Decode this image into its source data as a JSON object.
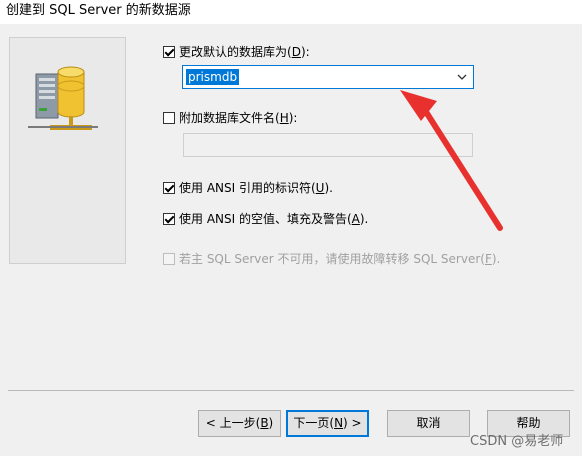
{
  "window": {
    "title": "创建到 SQL Server 的新数据源"
  },
  "options": {
    "change_default_db": {
      "label": "更改默认的数据库为(",
      "key": "D",
      "suffix": "):",
      "checked": true
    },
    "attach_db_file": {
      "label": "附加数据库文件名(",
      "key": "H",
      "suffix": "):",
      "checked": false
    },
    "ansi_quoted": {
      "label": "使用 ANSI 引用的标识符(",
      "key": "U",
      "suffix": ").",
      "checked": true
    },
    "ansi_nulls": {
      "label": "使用 ANSI 的空值、填充及警告(",
      "key": "A",
      "suffix": ").",
      "checked": true
    },
    "failover": {
      "label": "若主 SQL Server 不可用，请使用故障转移 SQL Server(",
      "key": "F",
      "suffix": ").",
      "checked": false,
      "disabled": true
    }
  },
  "database_combo": {
    "value": "prismdb"
  },
  "attach_file_input": {
    "value": ""
  },
  "buttons": {
    "back": {
      "pre": "< 上一步(",
      "key": "B",
      "post": ")"
    },
    "next": {
      "pre": "下一页(",
      "key": "N",
      "post": ") >"
    },
    "cancel": {
      "label": "取消"
    },
    "help": {
      "label": "帮助"
    }
  },
  "watermark": "CSDN @易老师",
  "colors": {
    "accent": "#0078d7",
    "annotation_arrow": "#e8312f"
  },
  "icons": {
    "server": "database-server-icon",
    "combo_arrow": "chevron-down-icon"
  }
}
